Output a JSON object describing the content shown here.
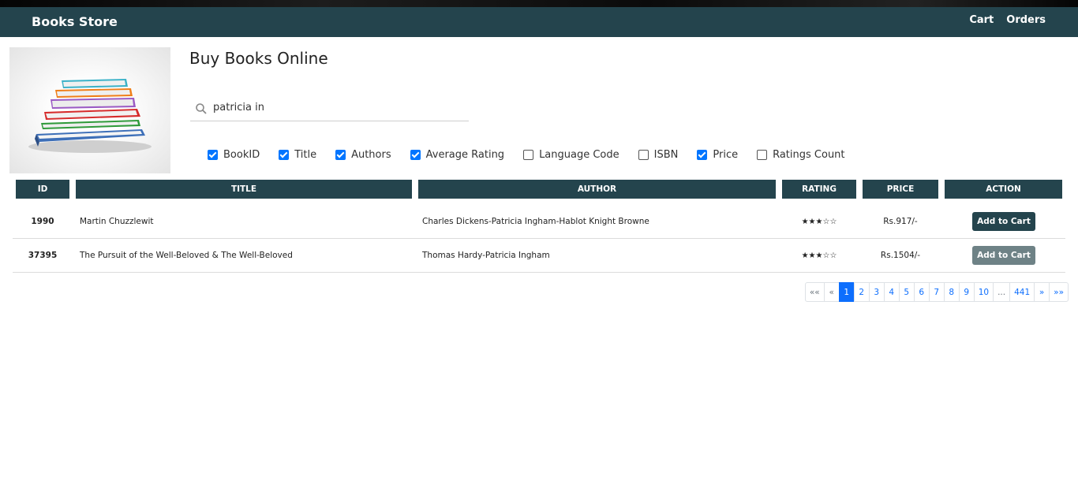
{
  "navbar": {
    "brand": "Books Store",
    "links": [
      "Cart",
      "Orders"
    ],
    "color": "#24444d"
  },
  "hero": {
    "image_icon": "book-stack-icon",
    "heading": "Buy Books Online"
  },
  "search": {
    "value": "patricia in",
    "icon": "search-icon"
  },
  "filters": [
    {
      "label": "BookID",
      "checked": true
    },
    {
      "label": "Title",
      "checked": true
    },
    {
      "label": "Authors",
      "checked": true
    },
    {
      "label": "Average Rating",
      "checked": true
    },
    {
      "label": "Language Code",
      "checked": false
    },
    {
      "label": "ISBN",
      "checked": false
    },
    {
      "label": "Price",
      "checked": true
    },
    {
      "label": "Ratings Count",
      "checked": false
    }
  ],
  "table": {
    "headers": [
      "ID",
      "TITLE",
      "AUTHOR",
      "RATING",
      "PRICE",
      "ACTION"
    ],
    "rows": [
      {
        "id": "1990",
        "title": "Martin Chuzzlewit",
        "author": "Charles Dickens-Patricia Ingham-Hablot Knight Browne",
        "rating": "★★★☆☆",
        "price": "Rs.917/-",
        "action": "Add to Cart"
      },
      {
        "id": "37395",
        "title": "The Pursuit of the Well-Beloved & The Well-Beloved",
        "author": "Thomas Hardy-Patricia Ingham",
        "rating": "★★★☆☆",
        "price": "Rs.1504/-",
        "action": "Add to Cart"
      }
    ]
  },
  "pagination": {
    "items": [
      "««",
      "«",
      "1",
      "2",
      "3",
      "4",
      "5",
      "6",
      "7",
      "8",
      "9",
      "10",
      "...",
      "441",
      "»",
      "»»"
    ],
    "active": "1"
  }
}
